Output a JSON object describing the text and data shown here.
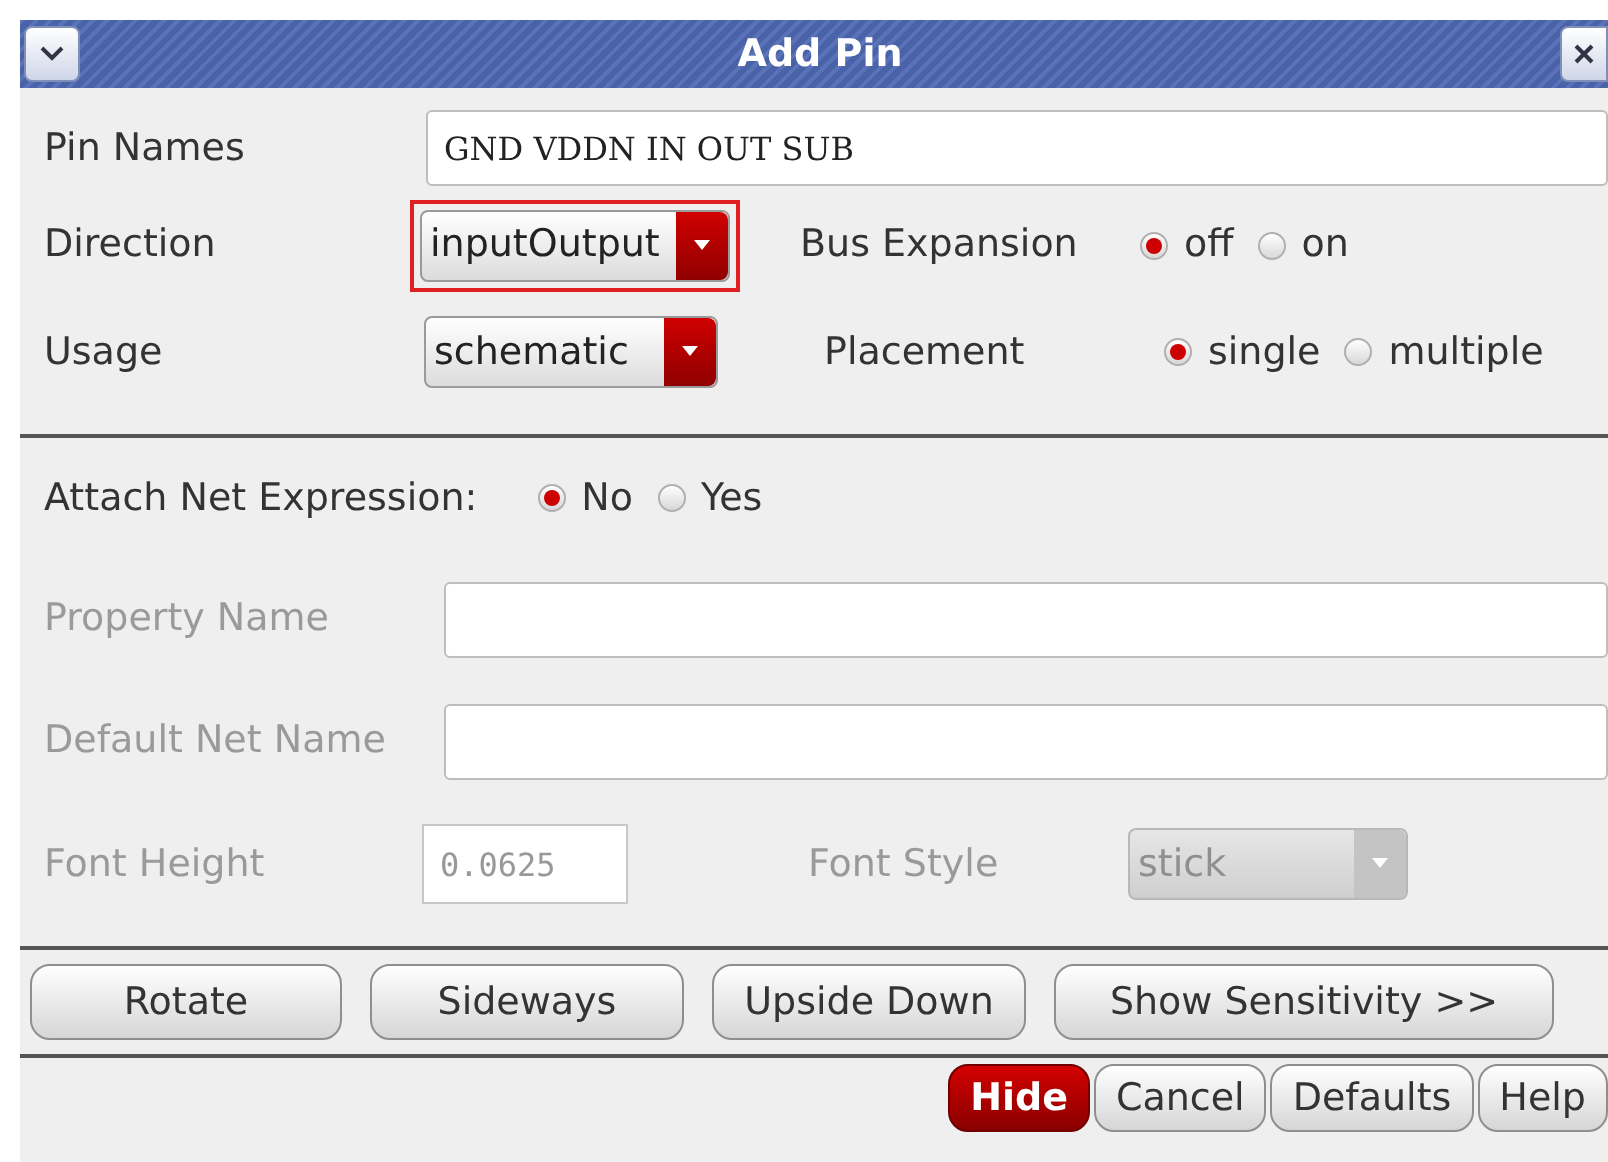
{
  "window": {
    "title": "Add Pin"
  },
  "pin_names": {
    "label": "Pin Names",
    "value": "GND VDDN IN OUT SUB"
  },
  "direction": {
    "label": "Direction",
    "value": "inputOutput",
    "highlighted": true
  },
  "bus_expansion": {
    "label": "Bus Expansion",
    "options": [
      {
        "label": "off",
        "selected": true
      },
      {
        "label": "on",
        "selected": false
      }
    ]
  },
  "usage": {
    "label": "Usage",
    "value": "schematic",
    "highlighted": false
  },
  "placement": {
    "label": "Placement",
    "options": [
      {
        "label": "single",
        "selected": true
      },
      {
        "label": "multiple",
        "selected": false
      }
    ]
  },
  "attach_net_expression": {
    "label": "Attach Net Expression:",
    "options": [
      {
        "label": "No",
        "selected": true
      },
      {
        "label": "Yes",
        "selected": false
      }
    ]
  },
  "property_name": {
    "label": "Property Name",
    "disabled": true
  },
  "default_net_name": {
    "label": "Default Net Name",
    "disabled": true
  },
  "font_height": {
    "label": "Font Height",
    "value": "0.0625",
    "disabled": true
  },
  "font_style": {
    "label": "Font Style",
    "value": "stick",
    "disabled": true
  },
  "orientation_buttons": [
    "Rotate",
    "Sideways",
    "Upside Down",
    "Show Sensitivity >>"
  ],
  "footer_buttons": [
    {
      "label": "Hide",
      "kind": "primary"
    },
    {
      "label": "Cancel",
      "kind": "normal"
    },
    {
      "label": "Defaults",
      "kind": "normal"
    },
    {
      "label": "Help",
      "kind": "normal"
    }
  ]
}
